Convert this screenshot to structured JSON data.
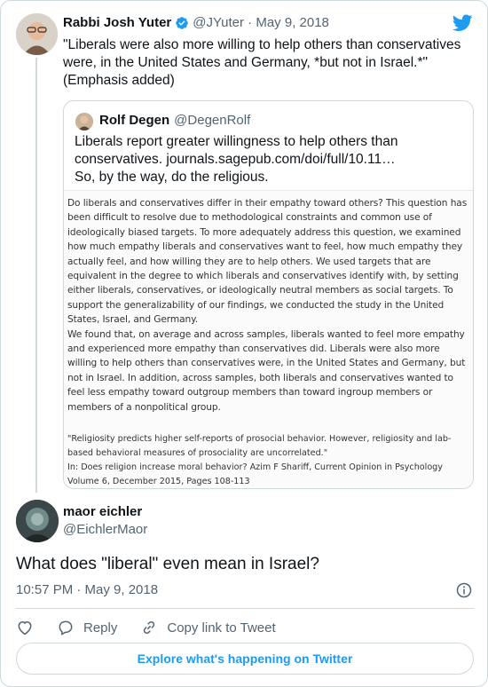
{
  "parent_tweet": {
    "name": "Rabbi Josh Yuter",
    "handle": "@JYuter · May 9, 2018",
    "text": "\"Liberals were also more willing to help others than conservatives were, in the United States and Germany, *but not in Israel.*\"\n(Emphasis added)"
  },
  "quoted_tweet": {
    "name": "Rolf Degen",
    "handle": "@DegenRolf",
    "text": "Liberals report greater willingness to help others than conservatives. journals.sagepub.com/doi/full/10.11…\nSo, by the way, do the religious.",
    "image_abstract": "   Do liberals and conservatives differ in their empathy toward others? This question has been difficult to resolve due to methodological constraints and common use of ideologically biased targets. To more adequately address this question, we examined how much empathy liberals and conservatives want to feel, how much empathy they actually feel, and how willing they are to help others. We used targets that are equivalent in the degree to which liberals and conservatives identify with, by setting either liberals, conservatives, or ideologically neutral members as social targets. To support the generalizability of our findings, we conducted the study in the United States, Israel, and Germany.\n   We found that, on average and across samples, liberals wanted to feel more empathy and experienced more empathy than conservatives did. Liberals were also more willing to help others than conservatives were, in the United States and Germany, but not in Israel. In addition, across samples, both liberals and conservatives wanted to feel less empathy toward outgroup members than toward ingroup members or members of a nonpolitical  group.",
    "image_citation": "   \"Religiosity predicts higher self-reports of prosocial behavior. However, religiosity and lab-based behavioral measures of prosociality are uncorrelated.\"\n      In: Does religion increase moral behavior? Azim F Shariff, Current Opinion in Psychology Volume 6, December 2015, Pages 108-113"
  },
  "reply_tweet": {
    "name": "maor eichler",
    "handle": "@EichlerMaor",
    "text": "What does \"liberal\" even mean in Israel?",
    "timestamp": "10:57 PM · May 9, 2018"
  },
  "actions": {
    "reply": "Reply",
    "copy_link": "Copy link to Tweet"
  },
  "explore_label": "Explore what's happening on Twitter",
  "colors": {
    "accent": "#1d9bf0",
    "text": "#0f1419",
    "muted": "#536471",
    "border": "#cfd9de"
  }
}
